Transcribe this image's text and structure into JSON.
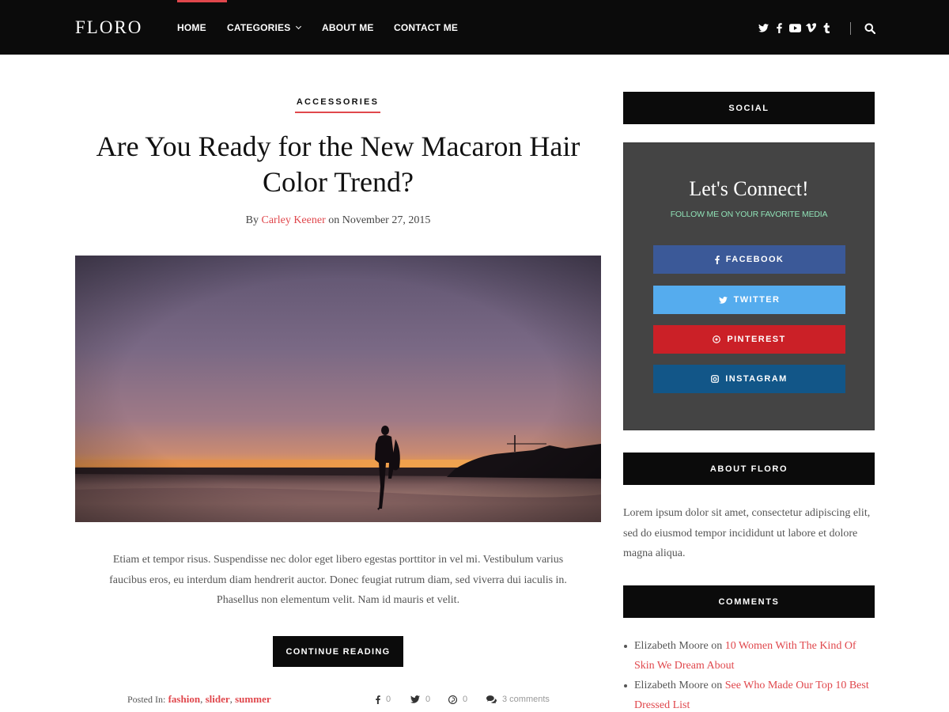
{
  "site": {
    "logo": "FLORO"
  },
  "nav": {
    "items": [
      "HOME",
      "CATEGORIES",
      "ABOUT ME",
      "CONTACT ME"
    ]
  },
  "header_social_icons": [
    "twitter-icon",
    "facebook-icon",
    "youtube-icon",
    "vimeo-icon",
    "tumblr-icon"
  ],
  "post": {
    "category": "ACCESSORIES",
    "title": "Are You Ready for the New Macaron Hair Color Trend?",
    "by": "By",
    "author": "Carley Keener",
    "on": "on November 27, 2015",
    "excerpt": "Etiam et tempor risus. Suspendisse nec dolor eget libero egestas porttitor in vel mi. Vestibulum varius faucibus eros, eu interdum diam hendrerit auctor. Donec feugiat rutrum diam, sed viverra dui iaculis in. Phasellus non elementum velit. Nam id mauris et velit.",
    "continue": "CONTINUE READING",
    "posted_in": "Posted In:",
    "tags": [
      "fashion",
      "slider",
      "summer"
    ],
    "shares": {
      "facebook": "0",
      "twitter": "0",
      "pinterest": "0",
      "comments": "3 comments"
    }
  },
  "sidebar": {
    "social_heading": "SOCIAL",
    "connect_title": "Let's Connect!",
    "connect_sub": "FOLLOW ME ON YOUR FAVORITE MEDIA",
    "buttons": [
      {
        "label": "FACEBOOK",
        "color": "#3b5998"
      },
      {
        "label": "TWITTER",
        "color": "#55acee"
      },
      {
        "label": "PINTEREST",
        "color": "#cb2027"
      },
      {
        "label": "INSTAGRAM",
        "color": "#125688"
      }
    ],
    "about_heading": "ABOUT FLORO",
    "about_text": "Lorem ipsum dolor sit amet, consectetur adipiscing elit, sed do eiusmod tempor incididunt ut labore et dolore magna aliqua.",
    "comments_heading": "COMMENTS",
    "comments": [
      {
        "author": "Elizabeth Moore",
        "on": "on",
        "post": "10 Women With The Kind Of Skin We Dream About"
      },
      {
        "author": "Elizabeth Moore",
        "on": "on",
        "post": "See Who Made Our Top 10 Best Dressed List"
      }
    ]
  },
  "colors": {
    "accent": "#e0474c",
    "header_bg": "#0b0b0b",
    "social_box_bg": "#444444",
    "connect_sub": "#8fe0b5"
  }
}
